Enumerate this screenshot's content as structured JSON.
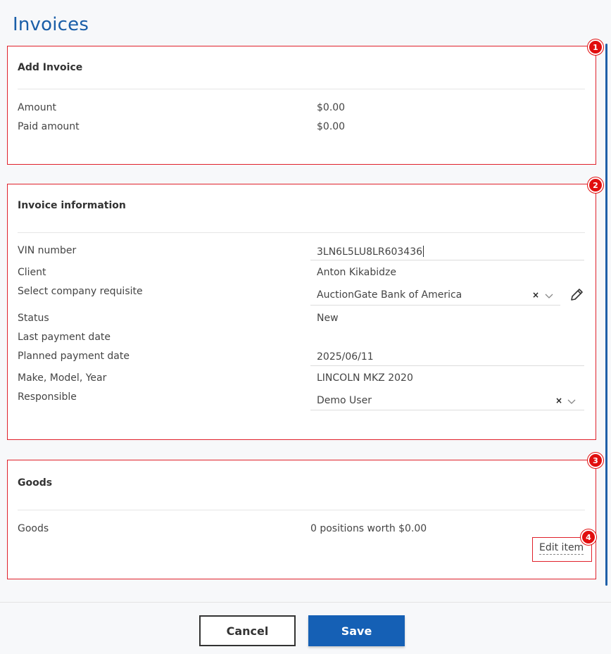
{
  "page": {
    "title": "Invoices"
  },
  "annotations": [
    "1",
    "2",
    "3",
    "4"
  ],
  "add_invoice": {
    "title": "Add Invoice",
    "rows": [
      {
        "label": "Amount",
        "value": "$0.00"
      },
      {
        "label": "Paid amount",
        "value": "$0.00"
      }
    ]
  },
  "invoice_info": {
    "title": "Invoice information",
    "vin": {
      "label": "VIN number",
      "value": "3LN6L5LU8LR603436"
    },
    "client": {
      "label": "Client",
      "value": "Anton Kikabidze"
    },
    "requisite": {
      "label": "Select company requisite",
      "value": "AuctionGate Bank of America"
    },
    "status": {
      "label": "Status",
      "value": "New"
    },
    "last_payment": {
      "label": "Last payment date",
      "value": ""
    },
    "planned_payment": {
      "label": "Planned payment date",
      "value": "2025/06/11"
    },
    "make_model": {
      "label": "Make, Model, Year",
      "value": "LINCOLN MKZ 2020"
    },
    "responsible": {
      "label": "Responsible",
      "value": "Demo User"
    }
  },
  "goods": {
    "title": "Goods",
    "label": "Goods",
    "value": "0 positions worth $0.00",
    "edit_label": "Edit item"
  },
  "footer": {
    "cancel_label": "Cancel",
    "save_label": "Save"
  },
  "icons": {
    "clear": "×",
    "chevron": "chevron-down-icon",
    "edit": "pencil-icon"
  },
  "colors": {
    "accent": "#1560b5",
    "title": "#1a5ea8",
    "annotation": "#e0212b"
  }
}
